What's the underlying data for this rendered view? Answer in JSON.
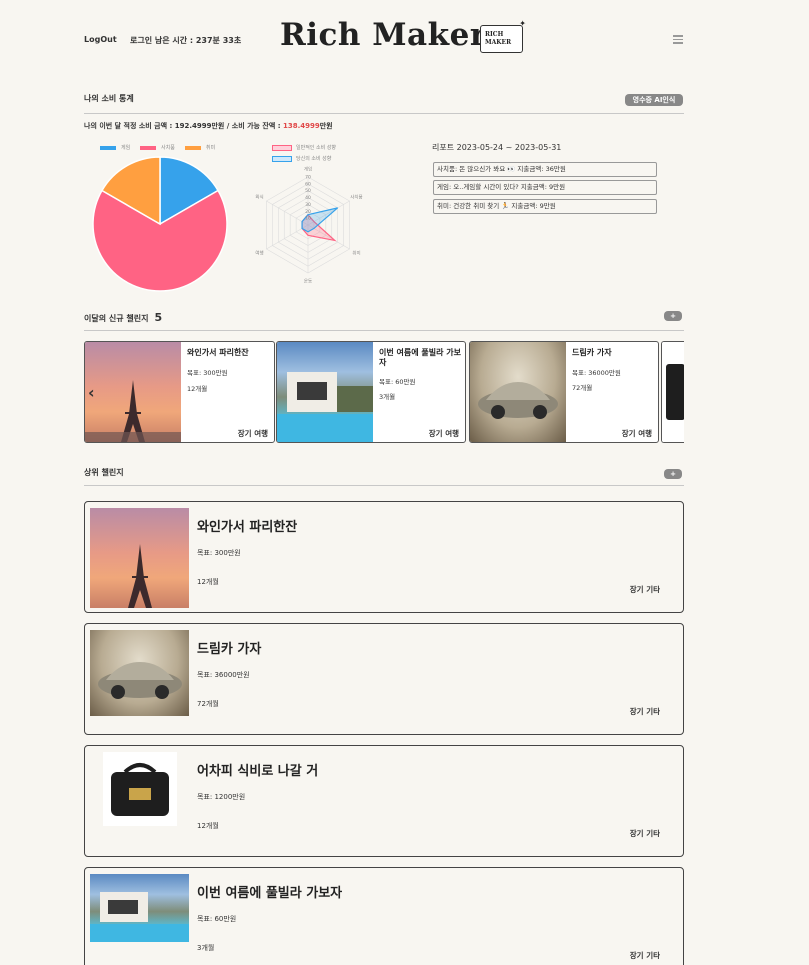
{
  "header": {
    "logout": "LogOut",
    "remaining_time": "로그인 남은 시간 : 237분 33초",
    "logo": "Rich Maker",
    "logo_badge_line1": "RICH",
    "logo_badge_line2": "MAKER"
  },
  "stats": {
    "title": "나의 소비 통계",
    "ai_button": "영수증 AI인식",
    "summary_prefix": "나의 이번 달 적정 소비 금액 : ",
    "proper_amount": "192.4999",
    "summary_mid": "만원 / 소비 가능 잔액 : ",
    "balance_amount": "138.4999",
    "summary_suffix": "만원"
  },
  "pie_legend": [
    {
      "label": "게임",
      "color": "#36a2eb"
    },
    {
      "label": "사치품",
      "color": "#ff6384"
    },
    {
      "label": "취미",
      "color": "#ff9f40"
    }
  ],
  "chart_data": [
    {
      "type": "pie",
      "categories": [
        "게임",
        "사치품",
        "취미"
      ],
      "values": [
        9,
        36,
        9
      ],
      "colors": [
        "#36a2eb",
        "#ff6384",
        "#ff9f40"
      ],
      "legend": "top"
    },
    {
      "type": "radar",
      "axes": [
        "게임",
        "사치품",
        "취미",
        "운동",
        "여행",
        "외식"
      ],
      "ticks": [
        70,
        60,
        50,
        40,
        30,
        20,
        10
      ],
      "rmax": 70,
      "series": [
        {
          "name": "일반적인 소비 성향",
          "values": [
            15,
            10,
            45,
            15,
            10,
            10
          ],
          "color": "#ff6384"
        },
        {
          "name": "당신의 소비 성향",
          "values": [
            15,
            50,
            10,
            10,
            10,
            10
          ],
          "color": "#36a2eb"
        }
      ],
      "legend": "top"
    }
  ],
  "radar_labels": {
    "axes": [
      "게임",
      "사치품",
      "취미",
      "운동",
      "여행",
      "외식"
    ],
    "ticks": [
      "70",
      "60",
      "50",
      "40",
      "30",
      "20",
      "10"
    ],
    "legend": [
      "일반적인 소비 성향",
      "당신의 소비 성향"
    ]
  },
  "report": {
    "title": "리포트 2023-05-24 ~ 2023-05-31",
    "items": [
      "사치품: 돈 많으신가 봐요 👀 지출금액: 36만원",
      "게임: 오..게임할 시간이 있다? 지출금액: 9만원",
      "취미: 건강한 취미 찾기 🏃 지출금액: 9만원"
    ]
  },
  "new_challenges": {
    "title": "이달의 신규 챌린지",
    "count": "5",
    "add": "+",
    "prev_icon": "‹",
    "items": [
      {
        "name": "와인가서 파리한잔",
        "goal": "목표: 300만원",
        "period": "12개월",
        "category": "장기 여행",
        "photo": "eiffel"
      },
      {
        "name": "이번 여름에 풀빌라 가보자",
        "goal": "목표: 60만원",
        "period": "3개월",
        "category": "장기 여행",
        "photo": "villa"
      },
      {
        "name": "드림카 가자",
        "goal": "목표: 36000만원",
        "period": "72개월",
        "category": "장기 여행",
        "photo": "car"
      }
    ]
  },
  "top_challenges": {
    "title": "상위 챌린지",
    "add": "+",
    "items": [
      {
        "name": "와인가서 파리한잔",
        "goal": "목표: 300만원",
        "period": "12개월",
        "category": "장기 기타",
        "photo": "eiffel"
      },
      {
        "name": "드림카 가자",
        "goal": "목표: 36000만원",
        "period": "72개월",
        "category": "장기 기타",
        "photo": "car"
      },
      {
        "name": "어차피 식비로 나갈 거",
        "goal": "목표: 1200만원",
        "period": "12개월",
        "category": "장기 기타",
        "photo": "bag"
      },
      {
        "name": "이번 여름에 풀빌라 가보자",
        "goal": "목표: 60만원",
        "period": "3개월",
        "category": "장기 기타",
        "photo": "villa"
      }
    ]
  }
}
